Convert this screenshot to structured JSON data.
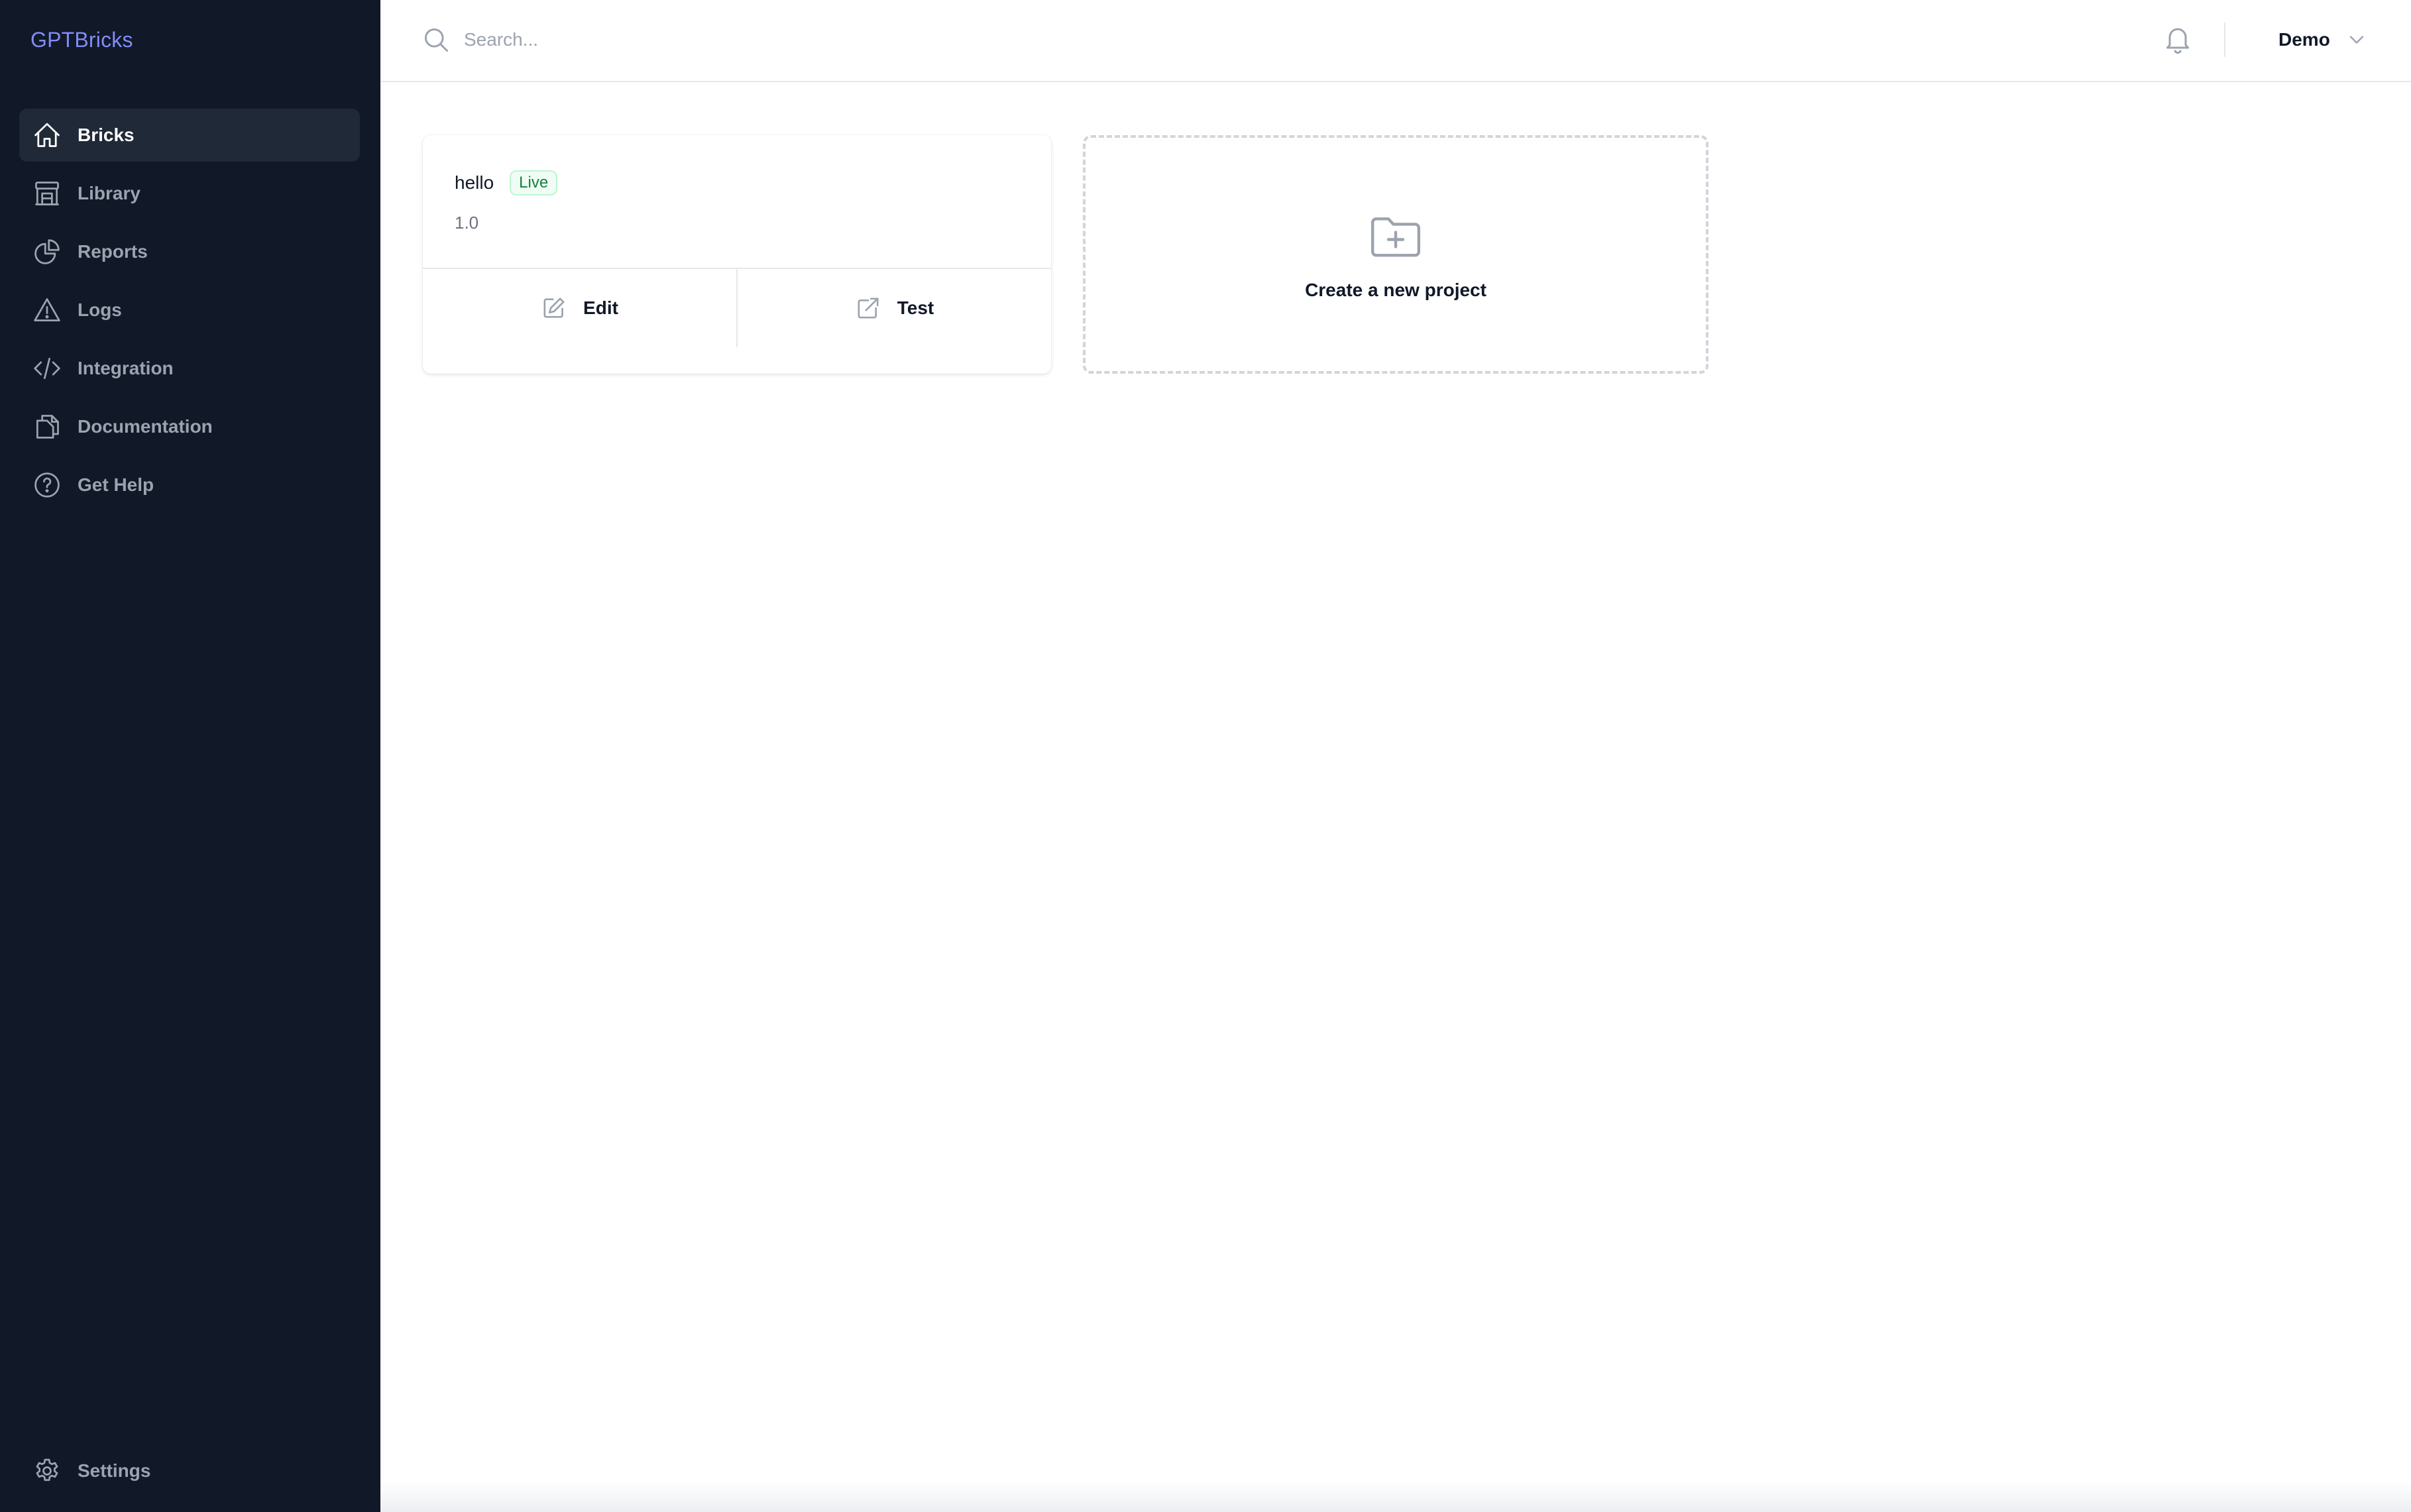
{
  "brand": "GPTBricks",
  "colors": {
    "sidebar_bg": "#111827",
    "sidebar_active": "#1f2937",
    "brand": "#818cf8",
    "badge_live": "#15803d"
  },
  "sidebar": {
    "items": [
      {
        "label": "Bricks",
        "icon": "home-icon",
        "active": true
      },
      {
        "label": "Library",
        "icon": "building-library-icon",
        "active": false
      },
      {
        "label": "Reports",
        "icon": "chart-pie-icon",
        "active": false
      },
      {
        "label": "Logs",
        "icon": "warning-triangle-icon",
        "active": false
      },
      {
        "label": "Integration",
        "icon": "code-brackets-icon",
        "active": false
      },
      {
        "label": "Documentation",
        "icon": "document-duplicate-icon",
        "active": false
      },
      {
        "label": "Get Help",
        "icon": "question-circle-icon",
        "active": false
      }
    ],
    "settings": {
      "label": "Settings",
      "icon": "gear-icon"
    }
  },
  "header": {
    "search_placeholder": "Search...",
    "search_value": "",
    "user_name": "Demo"
  },
  "main": {
    "project": {
      "name": "hello",
      "status": "Live",
      "version": "1.0",
      "edit_label": "Edit",
      "test_label": "Test"
    },
    "new_project_label": "Create a new project"
  }
}
